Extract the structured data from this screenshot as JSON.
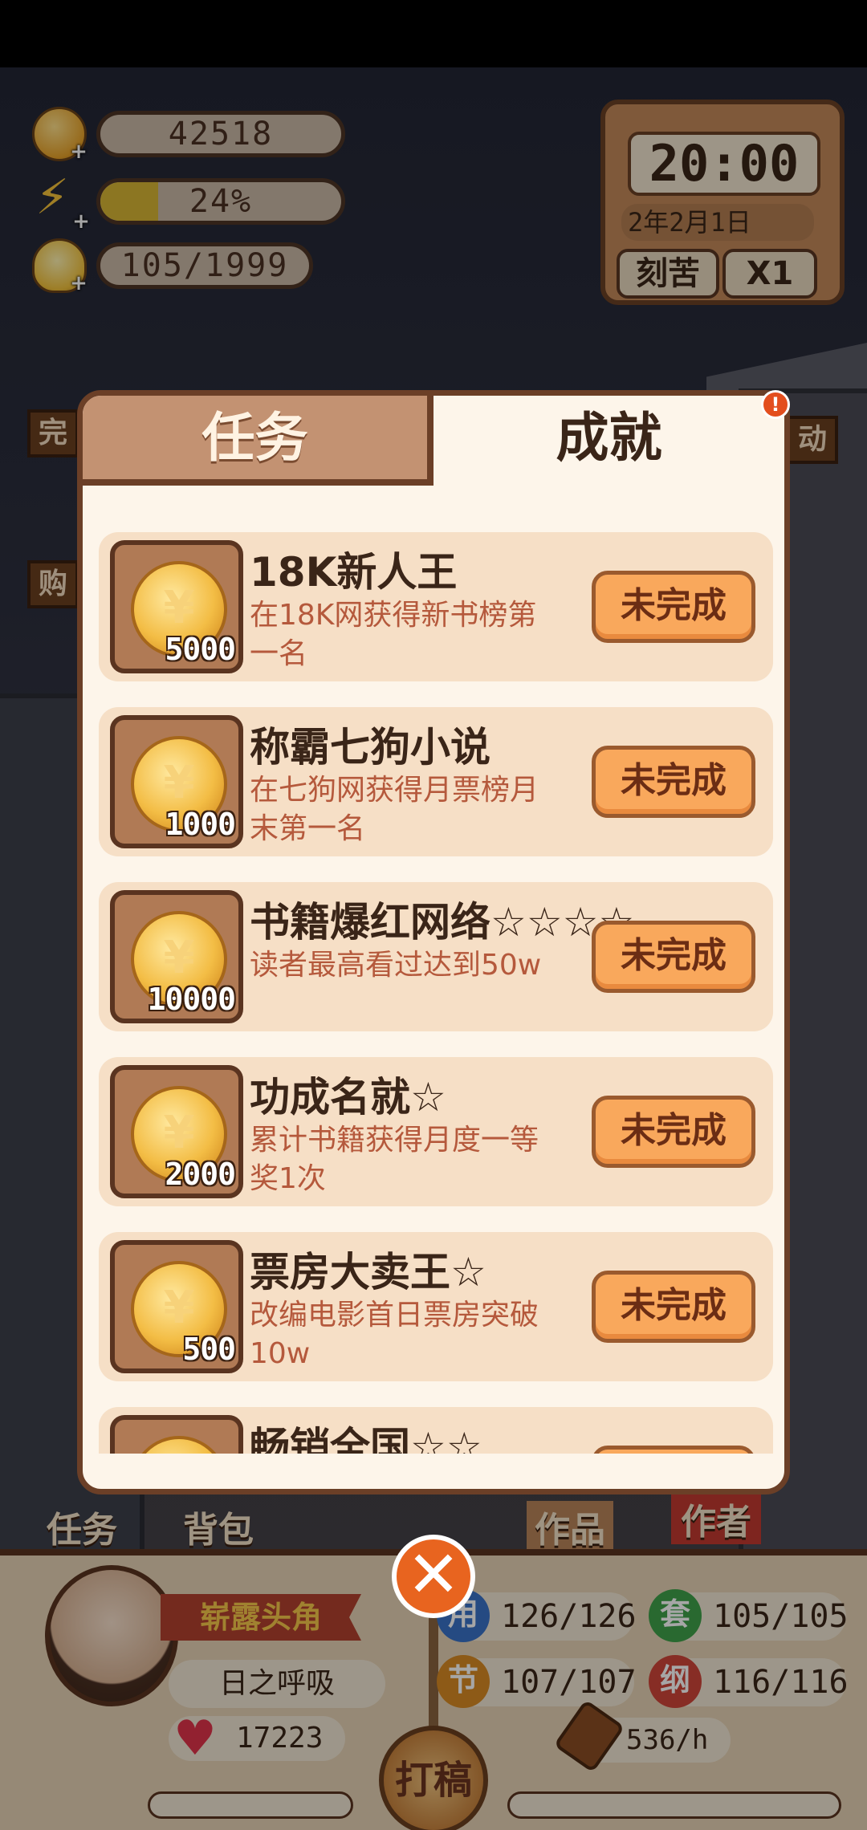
{
  "resources": {
    "coins": "42518",
    "energy": {
      "label": "24%",
      "fraction": 0.24
    },
    "ideas": "105/1999"
  },
  "clock": {
    "time": "20:00",
    "date": "2年2月1日",
    "mode_button": "刻苦",
    "speed_button": "X1"
  },
  "side_tags": {
    "left_top": "完",
    "left_mid": "购",
    "right_top": "动"
  },
  "modal": {
    "tabs": [
      {
        "label": "任务",
        "active": false
      },
      {
        "label": "成就",
        "active": true
      }
    ],
    "alert": "!",
    "achievements": [
      {
        "title": "18K新人王",
        "desc": "在18K网获得新书榜第一名",
        "reward": "5000",
        "status": "未完成"
      },
      {
        "title": "称霸七狗小说",
        "desc": "在七狗网获得月票榜月末第一名",
        "reward": "1000",
        "status": "未完成"
      },
      {
        "title": "书籍爆红网络☆☆☆☆",
        "desc": "读者最高看过达到50w",
        "reward": "10000",
        "status": "未完成"
      },
      {
        "title": "功成名就☆",
        "desc": "累计书籍获得月度一等奖1次",
        "reward": "2000",
        "status": "未完成"
      },
      {
        "title": "票房大卖王☆",
        "desc": "改编电影首日票房突破10w",
        "reward": "500",
        "status": "未完成"
      },
      {
        "title": "畅销全国☆☆",
        "desc": "",
        "reward": "",
        "status": ""
      }
    ],
    "coin_glyph": "¥",
    "close": "✕"
  },
  "bottom": {
    "tab_task": "任务",
    "tab_bag": "背包",
    "tab_works": "作品",
    "tab_author": "作者",
    "rank": "崭露头角",
    "name": "日之呼吸",
    "hearts": "17223",
    "stats": [
      {
        "icon": "用",
        "value": "126/126",
        "color": "#3a72c8"
      },
      {
        "icon": "套",
        "value": "105/105",
        "color": "#3fa24a"
      },
      {
        "icon": "节",
        "value": "107/107",
        "color": "#d98a24"
      },
      {
        "icon": "纲",
        "value": "116/116",
        "color": "#d0453a"
      }
    ],
    "speed": "536/h",
    "write_button": "打稿"
  }
}
